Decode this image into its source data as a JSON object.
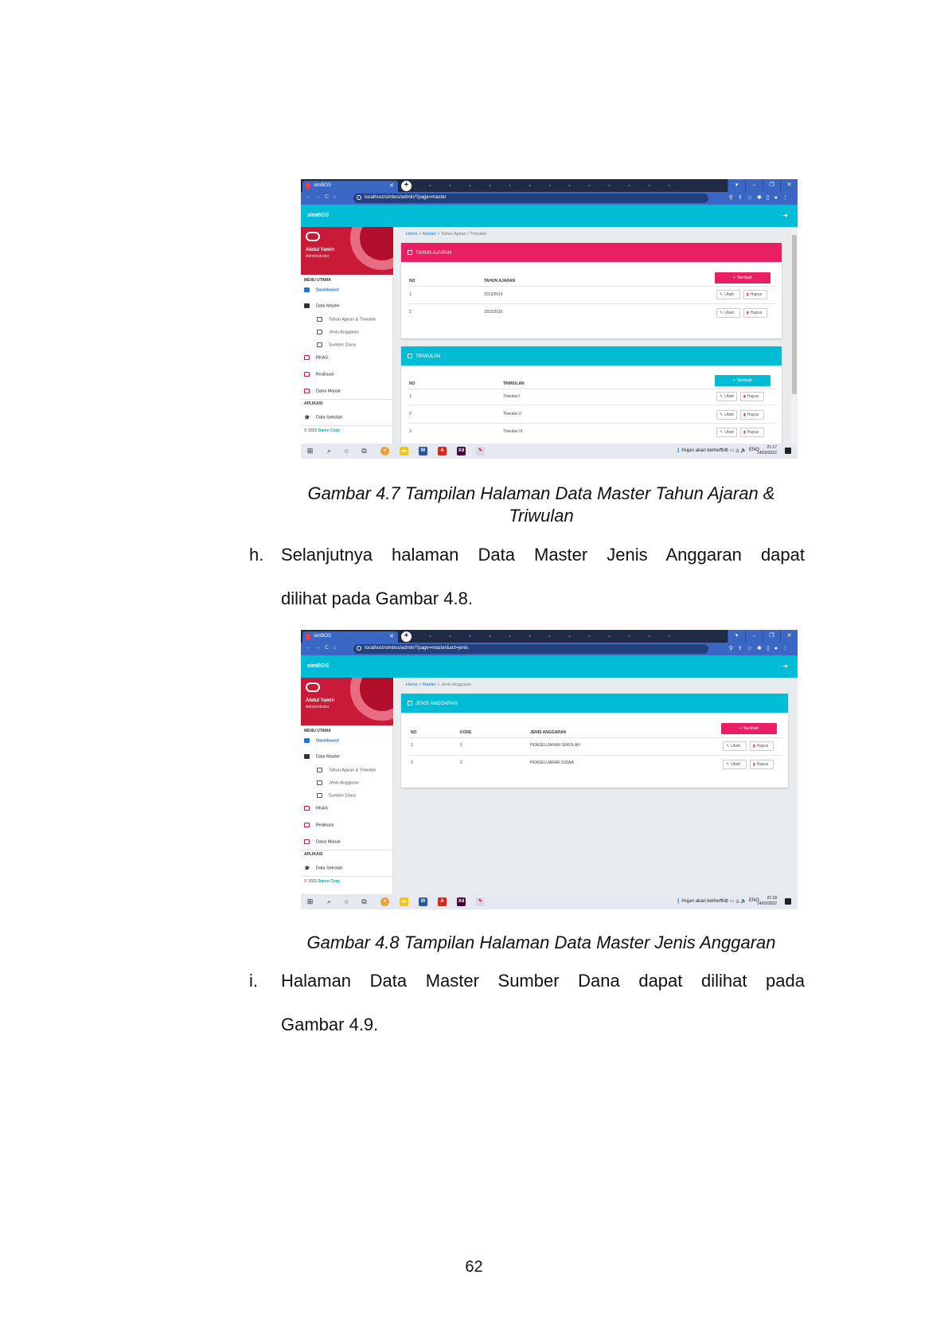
{
  "figure1": {
    "browser": {
      "tab_title": "simBOS",
      "url": "localhost/simbos/admin/?page=master",
      "window_buttons": [
        "▾",
        "–",
        "❐",
        "✕"
      ]
    },
    "app": {
      "name": "simBOS",
      "user_name": "Abdul Yamin",
      "user_role": "Administrator",
      "menu_header": "MENU UTAMA",
      "menu": {
        "dashboard": "Dashboard",
        "data_master": "Data Master",
        "tahun_ajaran_triwulan": "Tahun Ajaran & Triwulan",
        "jenis_anggaran": "Jenis Anggaran",
        "sumber_dana": "Sumber Dana",
        "rkas": "RKAS",
        "realisasi": "Realisasi",
        "dana_masuk": "Dana Masuk",
        "aplikasi_header": "APLIKASI",
        "data_sekolah": "Data Sekolah"
      },
      "copyright_prefix": "© 2022",
      "copyright_link": "Daren Corp"
    },
    "breadcrumb": {
      "home": "Home",
      "master": "Master",
      "current": "Tahun Ajaran / Triwulan"
    },
    "card_tahun": {
      "title": "TAHUN AJARAN",
      "add_label": "+ Tambah",
      "columns": [
        "NO",
        "TAHUN AJARAN"
      ],
      "rows": [
        {
          "no": "1",
          "tahun": "2013/2014"
        },
        {
          "no": "2",
          "tahun": "2015/2016"
        }
      ]
    },
    "card_triwulan": {
      "title": "TRIWULAN",
      "add_label": "+ Tambah",
      "columns": [
        "NO",
        "TRIWULAN"
      ],
      "rows": [
        {
          "no": "1",
          "triwulan": "Triwulan I"
        },
        {
          "no": "2",
          "triwulan": "Triwulan II"
        },
        {
          "no": "3",
          "triwulan": "Triwulan III"
        }
      ]
    },
    "actions": {
      "edit": "Ubah",
      "delete": "Hapus"
    },
    "taskbar": {
      "weather": "Hujan akan berhenti",
      "lang": "ENG",
      "time": "21:17",
      "date": "14/03/2022"
    }
  },
  "caption1_line1": "Gambar 4.7 Tampilan Halaman Data Master Tahun Ajaran &",
  "caption1_line2": "Triwulan",
  "para_h": {
    "marker": "h.",
    "line1": "Selanjutnya halaman Data Master Jenis Anggaran dapat",
    "line2": "dilihat pada Gambar 4.8."
  },
  "figure2": {
    "browser": {
      "tab_title": "simBOS",
      "url": "localhost/simbos/admin/?page=master&act=jenis"
    },
    "breadcrumb": {
      "home": "Home",
      "master": "Master",
      "current": "Jenis Anggaran"
    },
    "card_jenis": {
      "title": "JENIS ANGGARAN",
      "add_label": "+ Tambah",
      "columns": [
        "NO",
        "KODE",
        "JENIS ANGGARAN"
      ],
      "rows": [
        {
          "no": "1",
          "kode": "1",
          "jenis": "PENGELUARAN SEKOLAH"
        },
        {
          "no": "2",
          "kode": "2",
          "jenis": "PENGELUARAN SISWA"
        }
      ]
    },
    "taskbar": {
      "weather": "Hujan akan berhenti",
      "lang": "ENG",
      "time": "21:18",
      "date": "14/03/2022"
    }
  },
  "caption2": "Gambar 4.8 Tampilan Halaman Data Master Jenis Anggaran",
  "para_i": {
    "marker": "i.",
    "line1": "Halaman Data Master Sumber Dana dapat dilihat pada",
    "line2": "Gambar 4.9."
  },
  "page_number": "62"
}
